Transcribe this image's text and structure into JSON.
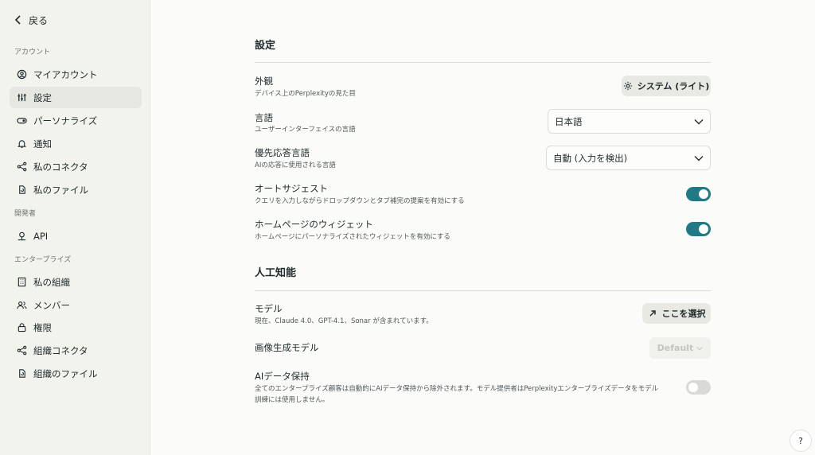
{
  "sidebar": {
    "back_label": "戻る",
    "sections": [
      {
        "label": "アカウント"
      },
      {
        "label": "開発者"
      },
      {
        "label": "エンタープライズ"
      }
    ],
    "items": [
      {
        "label": "マイアカウント",
        "icon": "account-circle-icon"
      },
      {
        "label": "設定",
        "icon": "sliders-icon",
        "active": true
      },
      {
        "label": "パーソナライズ",
        "icon": "toggle-icon"
      },
      {
        "label": "通知",
        "icon": "bell-icon"
      },
      {
        "label": "私のコネクタ",
        "icon": "connector-icon"
      },
      {
        "label": "私のファイル",
        "icon": "file-sync-icon"
      },
      {
        "label": "API",
        "icon": "api-icon"
      },
      {
        "label": "私の組織",
        "icon": "building-icon"
      },
      {
        "label": "メンバー",
        "icon": "users-icon"
      },
      {
        "label": "権限",
        "icon": "lock-icon"
      },
      {
        "label": "組織コネクタ",
        "icon": "connector-icon"
      },
      {
        "label": "組織のファイル",
        "icon": "file-sync-icon"
      }
    ]
  },
  "settings": {
    "title": "設定",
    "appearance": {
      "label": "外観",
      "desc": "デバイス上のPerplexityの見た目",
      "button": "システム (ライト)"
    },
    "language": {
      "label": "言語",
      "desc": "ユーザーインターフェイスの言語",
      "value": "日本語"
    },
    "response_language": {
      "label": "優先応答言語",
      "desc": "AIの応答に使用される言語",
      "value": "自動 (入力を検出)"
    },
    "autosuggest": {
      "label": "オートサジェスト",
      "desc": "クエリを入力しながらドロップダウンとタブ補完の提案を有効にする",
      "enabled": true
    },
    "homepage_widget": {
      "label": "ホームページのウィジェット",
      "desc": "ホームページにパーソナライズされたウィジェットを有効にする",
      "enabled": true
    }
  },
  "ai": {
    "title": "人工知能",
    "model": {
      "label": "モデル",
      "desc": "現在、Claude 4.0、GPT-4.1、Sonar が含まれています。",
      "button": "ここを選択"
    },
    "image_model": {
      "label": "画像生成モデル",
      "value": "Default"
    },
    "data_retention": {
      "label": "AIデータ保持",
      "desc_line1": "全てのエンタープライズ顧客は自動的にAIデータ保持から除外されます。モデル提供者はPerplexityエンタープライズデータをモデル",
      "desc_line2": "訓練には使用しません。",
      "enabled": false
    }
  },
  "help_label": "?",
  "colors": {
    "accent": "#207a86",
    "sidebar_bg": "#f3f3ee",
    "page_bg": "#fbfbf9"
  }
}
